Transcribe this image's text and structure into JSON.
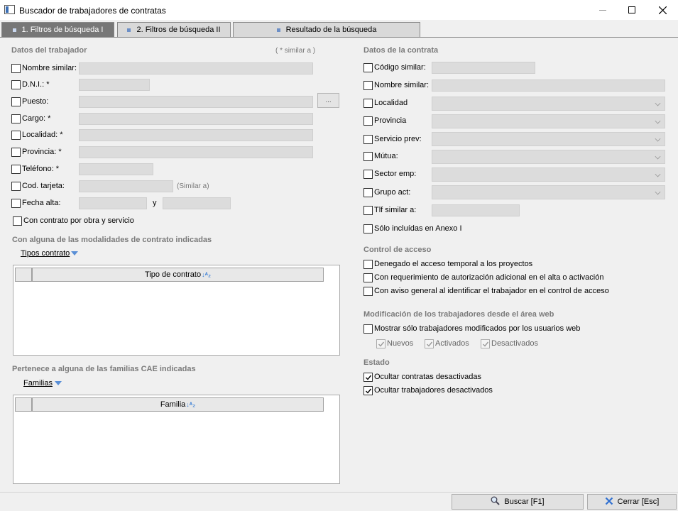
{
  "window": {
    "title": "Buscador de trabajadores de contratas",
    "minimize_icon": "minimize-icon",
    "maximize_icon": "maximize-icon",
    "close_icon": "close-icon"
  },
  "tabs": [
    {
      "label": "1. Filtros de búsqueda I",
      "active": true
    },
    {
      "label": "2. Filtros de búsqueda II",
      "active": false
    },
    {
      "label": "Resultado de la búsqueda",
      "active": false
    }
  ],
  "worker": {
    "title": "Datos del trabajador",
    "similar_hint": "( * similar a )",
    "fields": {
      "nombre": {
        "label": "Nombre similar:",
        "value": ""
      },
      "dni": {
        "label": "D.N.I.: *",
        "value": ""
      },
      "puesto": {
        "label": "Puesto:",
        "value": "",
        "button": "..."
      },
      "cargo": {
        "label": "Cargo: *",
        "value": ""
      },
      "localidad": {
        "label": "Localidad: *",
        "value": ""
      },
      "provincia": {
        "label": "Provincia: *",
        "value": ""
      },
      "telefono": {
        "label": "Teléfono: *",
        "value": ""
      },
      "tarjeta": {
        "label": "Cod. tarjeta:",
        "value": "",
        "hint": "(Similar a)"
      },
      "fecha": {
        "label": "Fecha alta:",
        "from": "",
        "to": "",
        "separator": "y"
      },
      "obra": {
        "label": "Con contrato por obra y servicio"
      }
    }
  },
  "modalidades": {
    "title": "Con alguna de las modalidades de contrato indicadas",
    "dropdown_label": "Tipos contrato",
    "column": "Tipo de contrato",
    "rows": []
  },
  "familias": {
    "title": "Pertenece a alguna de las familias CAE indicadas",
    "dropdown_label": "Familias",
    "column": "Familia",
    "rows": []
  },
  "contrata": {
    "title": "Datos de la contrata",
    "fields": {
      "codigo": {
        "label": "Código similar:",
        "value": ""
      },
      "nombre": {
        "label": "Nombre similar:",
        "value": ""
      },
      "localidad": {
        "label": "Localidad",
        "value": ""
      },
      "provincia": {
        "label": "Provincia",
        "value": ""
      },
      "servicio": {
        "label": "Servicio prev:",
        "value": ""
      },
      "mutua": {
        "label": "Mútua:",
        "value": ""
      },
      "sector": {
        "label": "Sector emp:",
        "value": ""
      },
      "grupo": {
        "label": "Grupo act:",
        "value": ""
      },
      "tlf": {
        "label": "Tlf similar a:",
        "value": ""
      },
      "anexo": {
        "label": "Sólo incluídas en Anexo I"
      }
    }
  },
  "acceso": {
    "title": "Control de acceso",
    "items": [
      {
        "label": "Denegado el acceso temporal a los proyectos",
        "checked": false
      },
      {
        "label": "Con requerimiento de autorización adicional en el alta o activación",
        "checked": false
      },
      {
        "label": "Con aviso general al identificar el trabajador en el control de acceso",
        "checked": false
      }
    ]
  },
  "modificacion": {
    "title": "Modificación de los trabajadores desde el área web",
    "main": {
      "label": "Mostrar sólo trabajadores modificados por los usuarios web",
      "checked": false
    },
    "sub": [
      {
        "label": "Nuevos",
        "checked": true
      },
      {
        "label": "Activados",
        "checked": true
      },
      {
        "label": "Desactivados",
        "checked": true
      }
    ]
  },
  "estado": {
    "title": "Estado",
    "items": [
      {
        "label": "Ocultar contratas desactivadas",
        "checked": true
      },
      {
        "label": "Ocultar trabajadores desactivados",
        "checked": true
      }
    ]
  },
  "footer": {
    "search": {
      "label": "Buscar  [F1]",
      "icon": "magnifier-icon"
    },
    "close": {
      "label": "Cerrar  [Esc]",
      "icon": "close-x-icon"
    }
  }
}
